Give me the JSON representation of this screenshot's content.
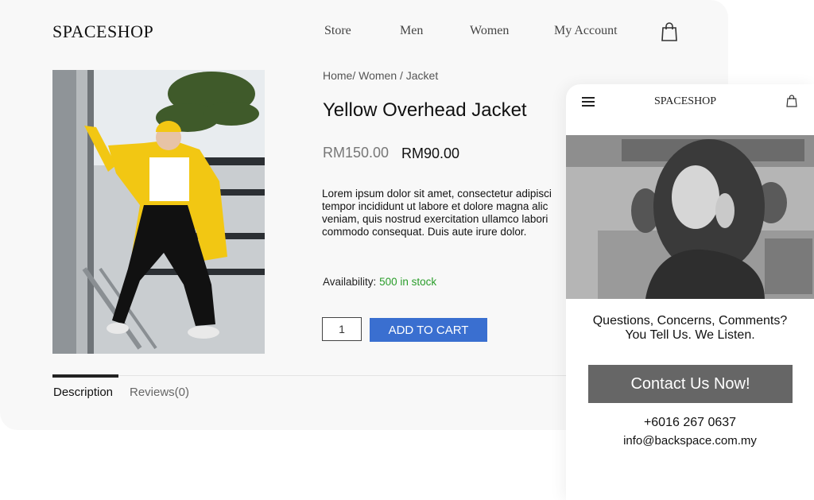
{
  "desktop": {
    "logo": "SPACESHOP",
    "nav": {
      "store": "Store",
      "men": "Men",
      "women": "Women",
      "account": "My Account"
    },
    "breadcrumb": "Home/ Women / Jacket",
    "product": {
      "title": "Yellow Overhead Jacket",
      "price_old": "RM150.00",
      "price_new": "RM90.00",
      "description_lines": [
        "Lorem ipsum dolor sit amet, consectetur adipisci",
        "tempor incididunt ut labore et dolore magna alic",
        "veniam, quis nostrud exercitation ullamco labori",
        "commodo consequat. Duis aute irure dolor."
      ],
      "availability_label": "Availability:",
      "availability_value": "500 in stock",
      "quantity": "1",
      "add_to_cart": "ADD TO CART"
    },
    "tabs": {
      "description": "Description",
      "reviews": "Reviews(0)"
    },
    "colors": {
      "accent_blue": "#3a6fd0",
      "stock_green": "#2a9d2a",
      "jacket_yellow": "#f2c713"
    }
  },
  "mobile": {
    "logo": "SPACESHOP",
    "question_line1": "Questions, Concerns, Comments?",
    "question_line2": "You Tell Us. We Listen.",
    "contact_button": "Contact Us Now!",
    "phone": "+6016 267 0637",
    "email": "info@backspace.com.my",
    "colors": {
      "button_gray": "#666666"
    }
  },
  "icons": [
    "shopping-bag-icon",
    "hamburger-menu-icon"
  ]
}
